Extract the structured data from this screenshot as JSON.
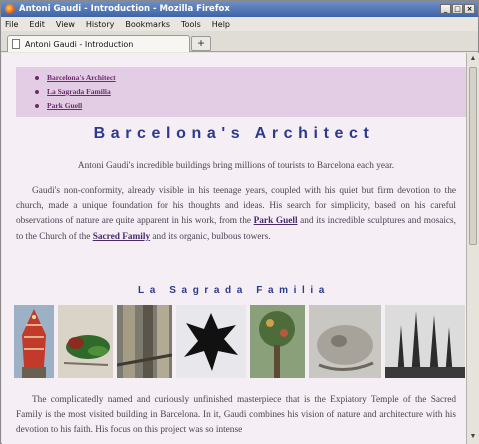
{
  "window": {
    "title": "Antoni Gaudi - Introduction - Mozilla Firefox",
    "controls": [
      "_",
      "□",
      "×"
    ]
  },
  "menubar": [
    "File",
    "Edit",
    "View",
    "History",
    "Bookmarks",
    "Tools",
    "Help"
  ],
  "tabs": [
    {
      "label": "Antoni Gaudi - Introduction"
    }
  ],
  "newtab_label": "+",
  "nav": {
    "items": [
      "Barcelona's Architect",
      "La Sagrada Familia",
      "Park Guell"
    ]
  },
  "page": {
    "heading": "Barcelona's Architect",
    "intro": "Antoni Gaudi's incredible buildings bring millions of tourists to Barcelona each year.",
    "p2_a": "Gaudi's non-conformity, already visible in his teenage years, coupled with his quiet but firm devotion to the church, made a unique foundation for his thoughts and ideas. His search for simplicity, based on his careful observations of nature are quite apparent in his work, from the ",
    "p2_link1": "Park Guell",
    "p2_b": " and its incredible sculptures and mosaics, to the Church of the ",
    "p2_link2": "Sacred Family",
    "p2_c": " and its organic, bulbous towers.",
    "subheading": "La Sagrada Familia",
    "p3": "The complicatedly named and curiously unfinished masterpiece that is the Expiatory Temple of the Sacred Family is the most visited building in Barcelona. In it, Gaudi combines his vision of nature and architecture with his devotion to his faith. His focus on this project was so intense"
  },
  "colors": {
    "page_bg": "#f5eef5",
    "nav_bg": "#e3cde4",
    "heading": "#2b3a8c",
    "link": "#6e2a6e",
    "text": "#4a4452"
  }
}
